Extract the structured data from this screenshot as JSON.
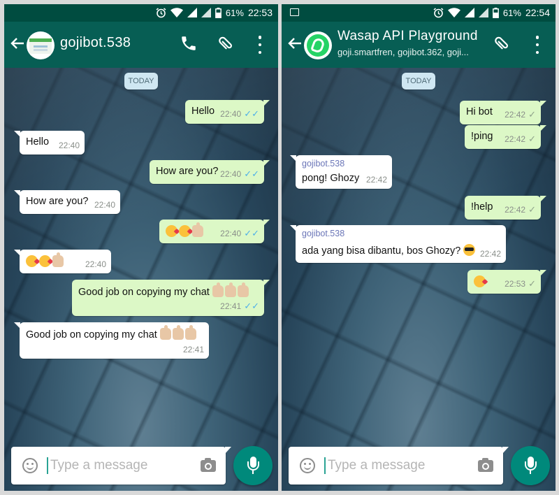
{
  "left": {
    "status": {
      "battery": "61%",
      "time": "22:53"
    },
    "header": {
      "title": "gojibot.538"
    },
    "date_chip": "TODAY",
    "messages": [
      {
        "dir": "out",
        "text": "Hello",
        "time": "22:40"
      },
      {
        "dir": "in",
        "text": "Hello",
        "time": "22:40"
      },
      {
        "dir": "out",
        "text": "How are you?",
        "time": "22:40"
      },
      {
        "dir": "in",
        "text": "How are you?",
        "time": "22:40"
      },
      {
        "dir": "out",
        "text": "",
        "time": "22:40"
      },
      {
        "dir": "in",
        "text": "",
        "time": "22:40"
      },
      {
        "dir": "out",
        "text": "Good job on copying my chat",
        "time": "22:41"
      },
      {
        "dir": "in",
        "text": "Good job on copying my chat",
        "time": "22:41"
      }
    ],
    "composer": {
      "placeholder": "Type a message"
    }
  },
  "right": {
    "status": {
      "battery": "61%",
      "time": "22:54"
    },
    "header": {
      "title": "Wasap API Playground",
      "subtitle": "goji.smartfren, gojibot.362, goji..."
    },
    "date_chip": "TODAY",
    "messages": [
      {
        "dir": "out",
        "text": "Hi bot",
        "time": "22:42"
      },
      {
        "dir": "out",
        "text": "!ping",
        "time": "22:42"
      },
      {
        "dir": "in",
        "sender": "gojibot.538",
        "text": "pong! Ghozy",
        "time": "22:42"
      },
      {
        "dir": "out",
        "text": "!help",
        "time": "22:42"
      },
      {
        "dir": "in",
        "sender": "gojibot.538",
        "text": "ada yang bisa dibantu, bos Ghozy?",
        "time": "22:42"
      },
      {
        "dir": "out",
        "text": "",
        "time": "22:53"
      }
    ],
    "composer": {
      "placeholder": "Type a message"
    }
  },
  "icons": {
    "back": "arrow-left-icon",
    "call": "phone-icon",
    "attach": "paperclip-icon",
    "menu": "more-vertical-icon",
    "emoji": "smiley-icon",
    "camera": "camera-icon",
    "mic": "microphone-icon"
  },
  "colors": {
    "status_bar": "#004c40",
    "app_bar": "#075e54",
    "outgoing_bubble": "#dcf8c6",
    "incoming_bubble": "#ffffff",
    "read_tick": "#4fb0e8",
    "fab": "#00897b"
  }
}
